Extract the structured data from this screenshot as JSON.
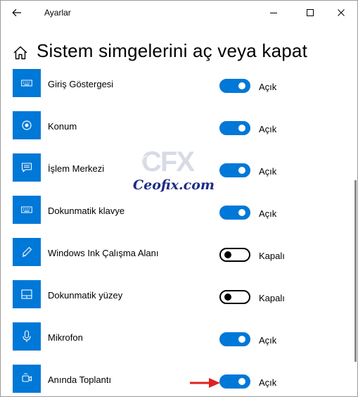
{
  "window": {
    "title": "Ayarlar",
    "back_icon": "back-arrow-icon",
    "minimize_icon": "minimize-icon",
    "maximize_icon": "maximize-icon",
    "close_icon": "close-icon"
  },
  "header": {
    "home_icon": "home-icon",
    "title": "Sistem simgelerini aç veya kapat"
  },
  "items": [
    {
      "label": "Giriş Göstergesi",
      "state": "Açık",
      "on": true,
      "icon": "keyboard-icon"
    },
    {
      "label": "Konum",
      "state": "Açık",
      "on": true,
      "icon": "location-icon"
    },
    {
      "label": "İşlem Merkezi",
      "state": "Açık",
      "on": true,
      "icon": "action-center-icon"
    },
    {
      "label": "Dokunmatik klavye",
      "state": "Açık",
      "on": true,
      "icon": "keyboard-icon"
    },
    {
      "label": "Windows Ink Çalışma Alanı",
      "state": "Kapalı",
      "on": false,
      "icon": "pen-icon"
    },
    {
      "label": "Dokunmatik yüzey",
      "state": "Kapalı",
      "on": false,
      "icon": "touchpad-icon"
    },
    {
      "label": "Mikrofon",
      "state": "Açık",
      "on": true,
      "icon": "microphone-icon"
    },
    {
      "label": "Anında Toplantı",
      "state": "Açık",
      "on": true,
      "icon": "meet-now-icon"
    }
  ],
  "watermark": {
    "logo_text": "CFX",
    "text": "Ceofix.com"
  },
  "colors": {
    "accent": "#0078d7",
    "arrow": "#e02020",
    "watermark_text": "#1f2a86"
  }
}
